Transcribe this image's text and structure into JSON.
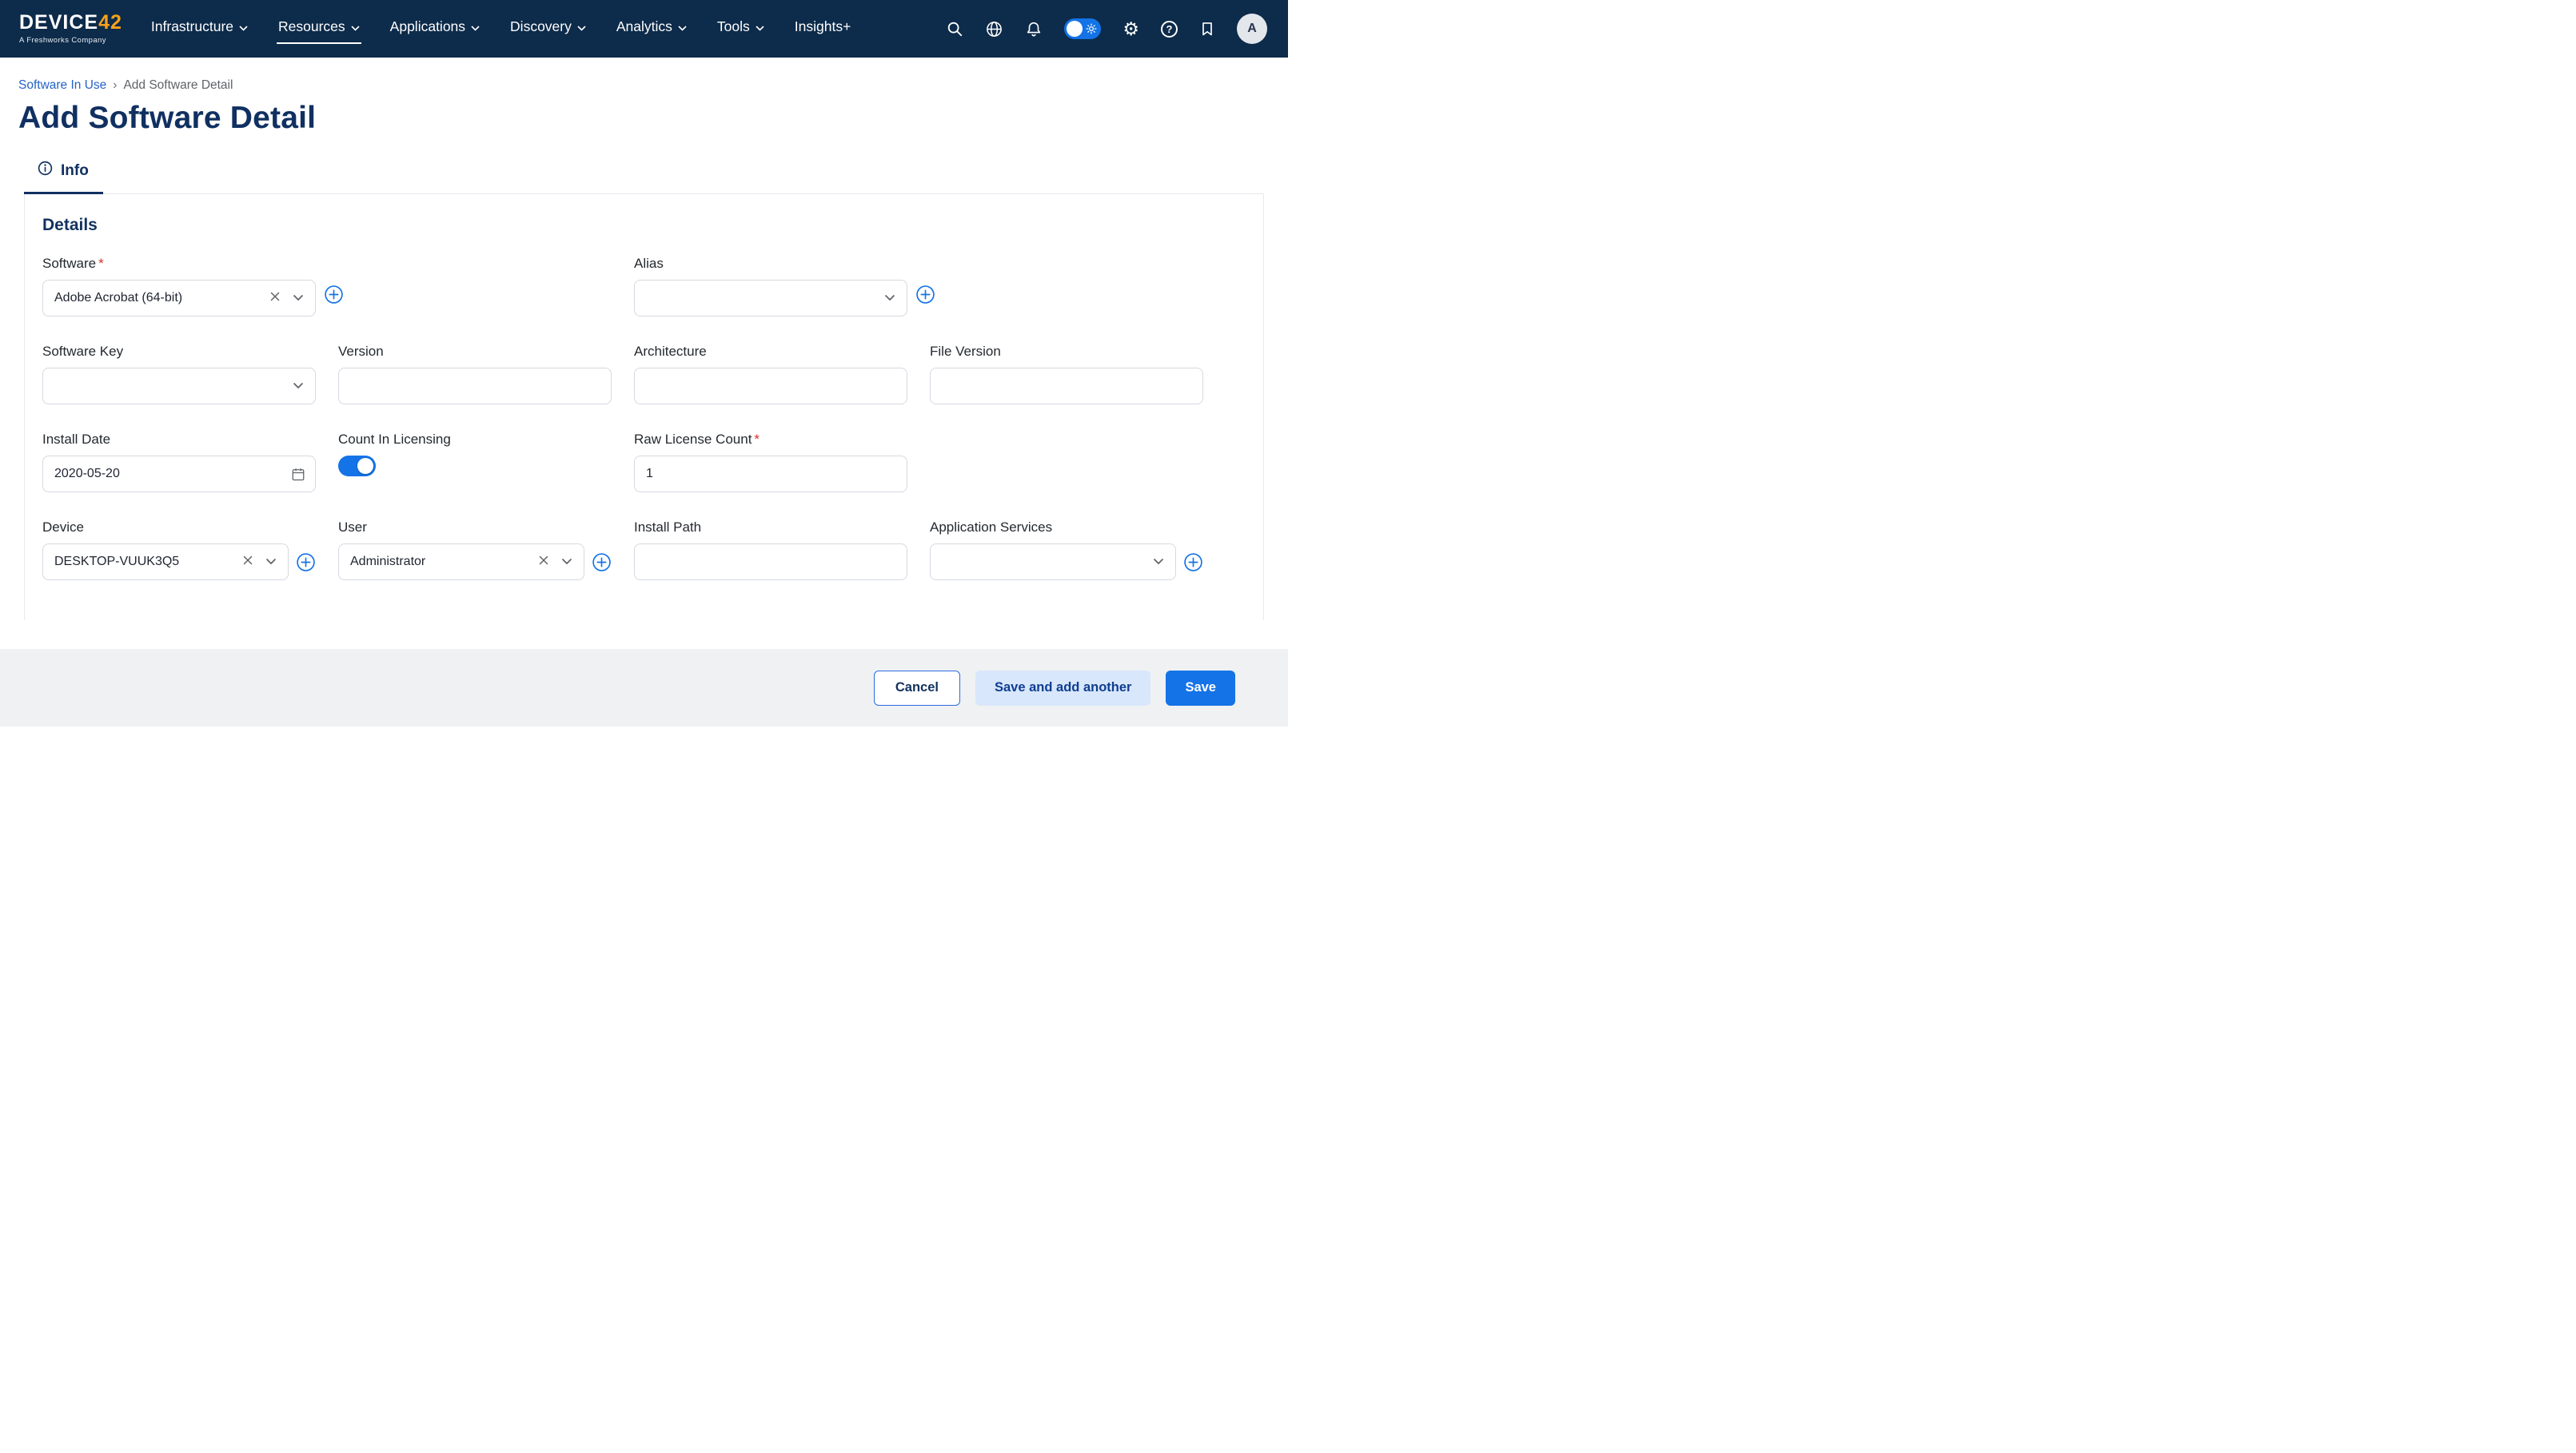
{
  "navbar": {
    "logo": {
      "main": "DEVICE",
      "accent": "42",
      "subtitle": "A Freshworks Company"
    },
    "items": [
      {
        "label": "Infrastructure"
      },
      {
        "label": "Resources"
      },
      {
        "label": "Applications"
      },
      {
        "label": "Discovery"
      },
      {
        "label": "Analytics"
      },
      {
        "label": "Tools"
      },
      {
        "label": "Insights+"
      }
    ],
    "avatar_initial": "A"
  },
  "breadcrumb": {
    "parent": "Software In Use",
    "separator": "›",
    "current": "Add Software Detail"
  },
  "page_title": "Add Software Detail",
  "tab_info": "Info",
  "section_title": "Details",
  "ui": {
    "required_marker": "*"
  },
  "fields": {
    "software": {
      "label": "Software",
      "value": "Adobe Acrobat (64-bit)"
    },
    "alias": {
      "label": "Alias",
      "value": ""
    },
    "software_key": {
      "label": "Software Key",
      "value": ""
    },
    "version": {
      "label": "Version",
      "value": ""
    },
    "architecture": {
      "label": "Architecture",
      "value": ""
    },
    "file_version": {
      "label": "File Version",
      "value": ""
    },
    "install_date": {
      "label": "Install Date",
      "value": "2020-05-20"
    },
    "count_in_licensing": {
      "label": "Count In Licensing",
      "state": "on"
    },
    "raw_license_count": {
      "label": "Raw License Count",
      "value": "1"
    },
    "device": {
      "label": "Device",
      "value": "DESKTOP-VUUK3Q5"
    },
    "user": {
      "label": "User",
      "value": "Administrator"
    },
    "install_path": {
      "label": "Install Path",
      "value": ""
    },
    "application_services": {
      "label": "Application Services",
      "value": ""
    }
  },
  "footer": {
    "cancel": "Cancel",
    "save_add_another": "Save and add another",
    "save": "Save"
  },
  "colors": {
    "navbar_bg": "#0d2b4a",
    "primary_blue": "#1473e6",
    "title_navy": "#103061",
    "link_blue": "#2563c9",
    "required_red": "#d93025",
    "logo_accent": "#f7a11b"
  }
}
